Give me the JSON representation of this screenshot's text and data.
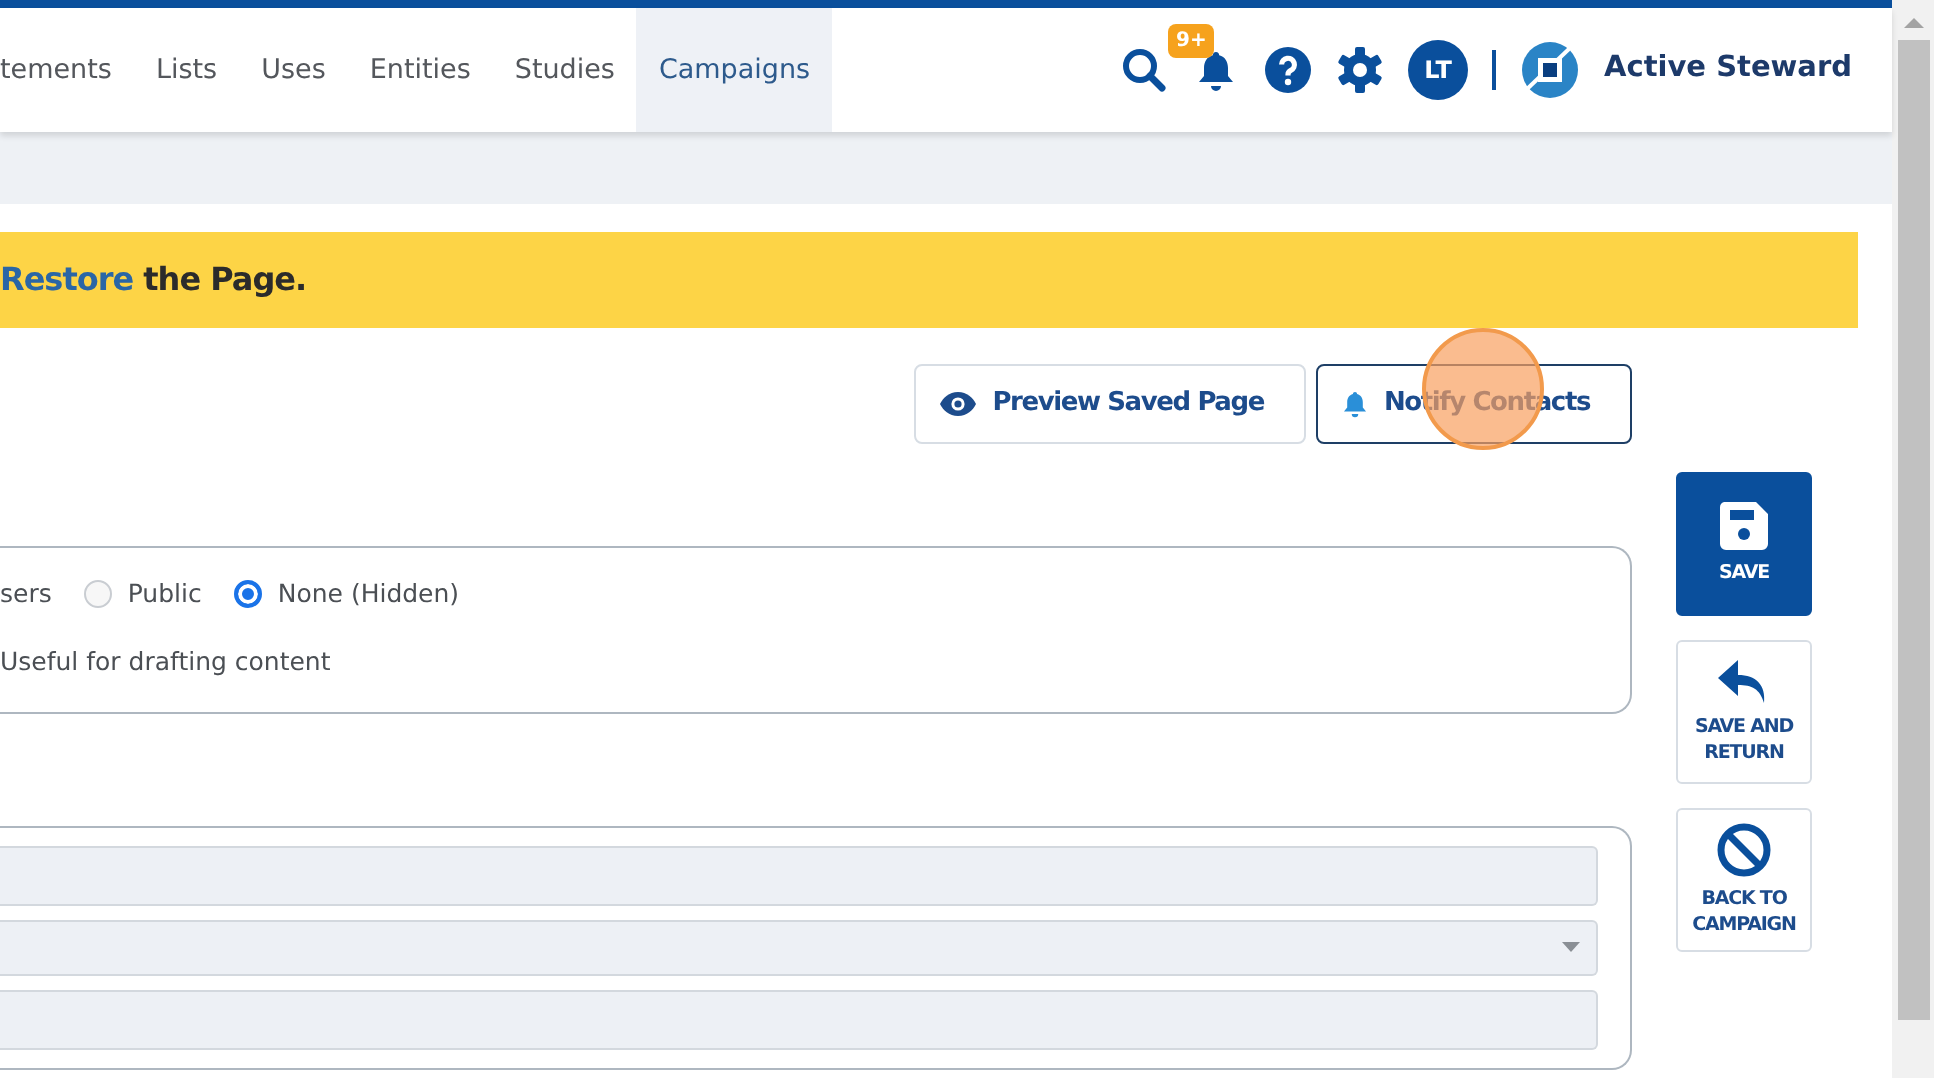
{
  "nav": {
    "items": [
      {
        "label": "tements",
        "selected": false
      },
      {
        "label": "Lists",
        "selected": false
      },
      {
        "label": "Uses",
        "selected": false
      },
      {
        "label": "Entities",
        "selected": false
      },
      {
        "label": "Studies",
        "selected": false
      },
      {
        "label": "Campaigns",
        "selected": true
      }
    ],
    "notification_badge": "9+",
    "avatar_initials": "LT",
    "brand": "Active Steward"
  },
  "banner": {
    "link": "Restore",
    "text": " the Page."
  },
  "actions": [
    {
      "label": "Preview Saved Page",
      "kind": "preview"
    },
    {
      "label": "Notify Contacts",
      "kind": "notify"
    }
  ],
  "visibility": {
    "cut_label": "sers",
    "options": [
      {
        "label": "Public",
        "selected": false
      },
      {
        "label": "None (Hidden)",
        "selected": true
      }
    ],
    "hint": "Useful for drafting content"
  },
  "fields": [
    {
      "kind": "text"
    },
    {
      "kind": "select"
    },
    {
      "kind": "text"
    }
  ],
  "side_buttons": [
    {
      "kind": "save",
      "label": "SAVE",
      "primary": true
    },
    {
      "kind": "return",
      "label": "SAVE AND RETURN",
      "primary": false
    },
    {
      "kind": "back",
      "label": "BACK TO CAMPAIGN",
      "primary": false
    }
  ]
}
